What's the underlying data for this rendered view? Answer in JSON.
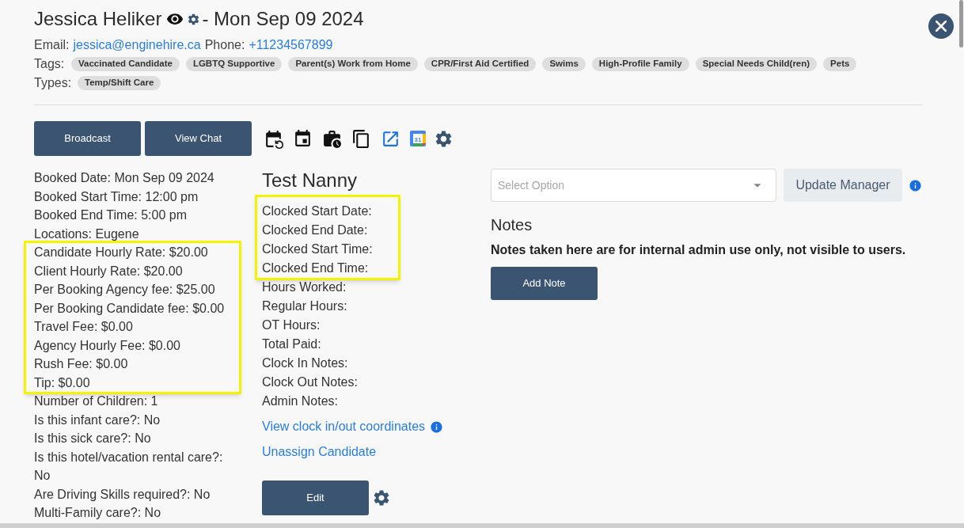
{
  "header": {
    "name": "Jessica Heliker",
    "date": "- Mon Sep 09 2024",
    "email_label": "Email:",
    "email": "jessica@enginehire.ca",
    "phone_label": "Phone:",
    "phone": "+11234567899"
  },
  "tags": {
    "label": "Tags:",
    "items": [
      "Vaccinated Candidate",
      "LGBTQ Supportive",
      "Parent(s) Work from Home",
      "CPR/First Aid Certified",
      "Swims",
      "High-Profile Family",
      "Special Needs Child(ren)",
      "Pets"
    ]
  },
  "types": {
    "label": "Types:",
    "items": [
      "Temp/Shift Care"
    ]
  },
  "actions": {
    "buttons": [
      "Broadcast",
      "View Chat"
    ],
    "calendar_badge_text": "31"
  },
  "booking_details": [
    {
      "highlighted": false,
      "lines": [
        "Booked Date: Mon Sep 09 2024",
        "Booked Start Time: 12:00 pm",
        "Booked End Time: 5:00 pm",
        "Locations: Eugene"
      ]
    },
    {
      "highlighted": true,
      "lines": [
        "Candidate Hourly Rate: $20.00",
        "Client Hourly Rate: $20.00",
        "Per Booking Agency fee: $25.00",
        "Per Booking Candidate fee: $0.00",
        "Travel Fee: $0.00",
        "Agency Hourly Fee: $0.00",
        "Rush Fee: $0.00",
        "Tip: $0.00"
      ]
    },
    {
      "highlighted": false,
      "lines": [
        "Number of Children: 1",
        "Is this infant care?: No",
        "Is this sick care?: No",
        "Is this hotel/vacation rental care?: No",
        "Are Driving Skills required?: No",
        "Multi-Family care?: No"
      ]
    }
  ],
  "candidate": {
    "name": "Test Nanny",
    "groups": [
      {
        "highlighted": true,
        "lines": [
          "Clocked Start Date:",
          "Clocked End Date:",
          "Clocked Start Time:",
          "Clocked End Time:"
        ]
      },
      {
        "highlighted": false,
        "lines": [
          "Hours Worked:",
          "Regular Hours:",
          "OT Hours:",
          "Total Paid:",
          "Clock In Notes:",
          "Clock Out Notes:",
          "Admin Notes:"
        ]
      }
    ],
    "links": [
      {
        "label": "View clock in/out coordinates",
        "info": true
      },
      {
        "label": "Unassign Candidate",
        "info": false
      }
    ],
    "edit_button": "Edit"
  },
  "manager": {
    "placeholder": "Select Option",
    "button": "Update Manager"
  },
  "notes": {
    "title": "Notes",
    "disclaimer": "Notes taken here are for internal admin use only, not visible to users.",
    "button": "Add Note"
  }
}
